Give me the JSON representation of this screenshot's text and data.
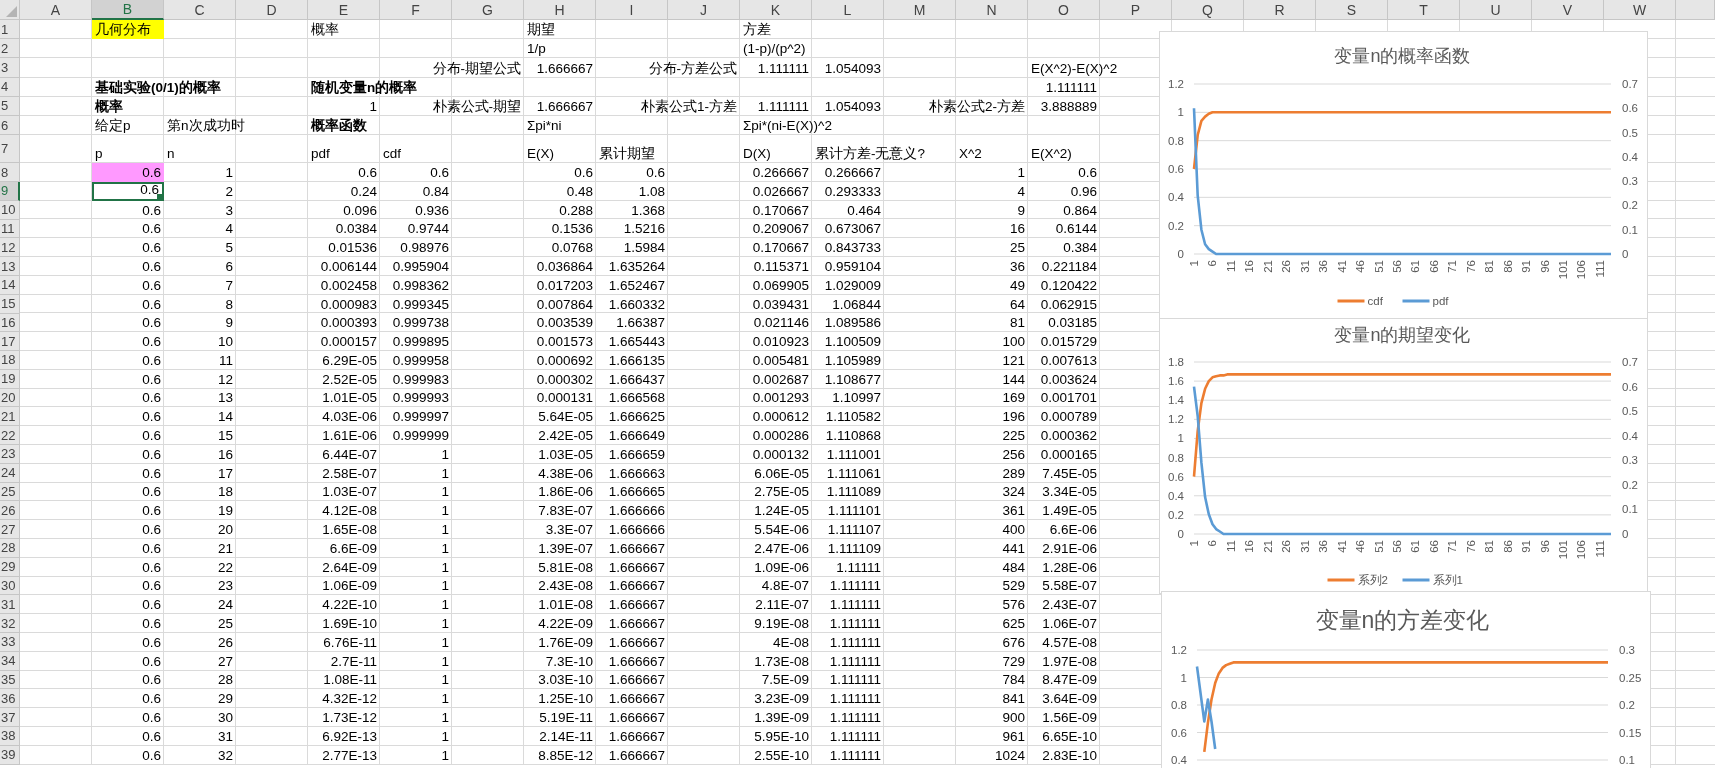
{
  "columns": [
    {
      "letter": "A",
      "selected": false
    },
    {
      "letter": "B",
      "selected": true
    },
    {
      "letter": "C",
      "selected": false
    },
    {
      "letter": "D",
      "selected": false
    },
    {
      "letter": "E",
      "selected": false
    },
    {
      "letter": "F",
      "selected": false
    },
    {
      "letter": "G",
      "selected": false
    },
    {
      "letter": "H",
      "selected": false
    },
    {
      "letter": "I",
      "selected": false
    },
    {
      "letter": "J",
      "selected": false
    },
    {
      "letter": "K",
      "selected": false
    },
    {
      "letter": "L",
      "selected": false
    },
    {
      "letter": "M",
      "selected": false
    },
    {
      "letter": "N",
      "selected": false
    },
    {
      "letter": "O",
      "selected": false
    },
    {
      "letter": "P",
      "selected": false
    },
    {
      "letter": "Q",
      "selected": false
    },
    {
      "letter": "R",
      "selected": false
    },
    {
      "letter": "S",
      "selected": false
    },
    {
      "letter": "T",
      "selected": false
    },
    {
      "letter": "U",
      "selected": false
    },
    {
      "letter": "V",
      "selected": false
    },
    {
      "letter": "W",
      "selected": false
    }
  ],
  "top_rows": [
    {
      "row": "1",
      "cells": [
        {},
        {
          "text": "几何分布",
          "color": "#ffff00"
        },
        {},
        {},
        {
          "text": "概率"
        },
        {},
        {},
        {
          "text": "期望"
        },
        {},
        {},
        {
          "text": "方差"
        }
      ]
    },
    {
      "row": "2",
      "cells": [
        {},
        {},
        {},
        {},
        {},
        {},
        {},
        {
          "text": "1/p"
        },
        {},
        {},
        {
          "text": "(1-p)/(p^2)"
        }
      ]
    },
    {
      "row": "3",
      "cells": [
        {},
        {},
        {},
        {},
        {},
        {},
        {
          "text": "分布-期望公式",
          "kind": "right"
        },
        {
          "text": "1.666667",
          "kind": "right"
        },
        {},
        {
          "text": "分布-方差公式",
          "kind": "right"
        },
        {
          "text": "1.111111",
          "kind": "right"
        },
        {
          "text": "1.054093",
          "kind": "right"
        },
        {},
        {},
        {
          "text": "E(X^2)-E(X)^2"
        }
      ]
    },
    {
      "row": "4",
      "cells": [
        {},
        {
          "text": "基础实验(0/1)的概率",
          "bold": true
        },
        {},
        {},
        {
          "text": "随机变量n的概率",
          "bold": true
        },
        {},
        {},
        {},
        {},
        {},
        {},
        {},
        {},
        {},
        {
          "text": "1.111111",
          "kind": "right"
        }
      ]
    },
    {
      "row": "5",
      "cells": [
        {},
        {
          "text": "概率",
          "bold": true
        },
        {},
        {},
        {
          "text": "1",
          "kind": "right"
        },
        {},
        {
          "text": "朴素公式-期望",
          "kind": "right"
        },
        {
          "text": "1.666667",
          "kind": "right"
        },
        {},
        {
          "text": "朴素公式1-方差",
          "kind": "right"
        },
        {
          "text": "1.111111",
          "kind": "right"
        },
        {
          "text": "1.054093",
          "kind": "right"
        },
        {},
        {
          "text": "朴素公式2-方差",
          "kind": "right"
        },
        {
          "text": "3.888889",
          "kind": "right"
        }
      ]
    },
    {
      "row": "6",
      "cells": [
        {},
        {
          "text": "给定p"
        },
        {
          "text": "第n次成功时"
        },
        {},
        {
          "text": "概率函数",
          "bold": true
        },
        {},
        {},
        {
          "text": "Σpi*ni"
        },
        {},
        {},
        {
          "text": "Σpi*(ni-E(X))^2"
        }
      ]
    },
    {
      "row": "7",
      "cells": [
        {},
        {
          "text": "p"
        },
        {
          "text": "n"
        },
        {},
        {
          "text": "pdf"
        },
        {
          "text": "cdf"
        },
        {},
        {
          "text": "E(X)"
        },
        {
          "text": "累计期望"
        },
        {},
        {
          "text": "D(X)"
        },
        {
          "text": "累计方差-无意义?"
        },
        {},
        {
          "text": "X^2"
        },
        {
          "text": "E(X^2)"
        }
      ]
    }
  ],
  "rows": [
    {
      "row": "8",
      "selected": false,
      "color": "#ff99ff",
      "cells": [
        "0.6",
        "1",
        "0.6",
        "0.6",
        "0.6",
        "0.6",
        "0.266667",
        "0.266667",
        "1",
        "0.6"
      ]
    },
    {
      "row": "9",
      "selected": true,
      "cells": [
        "0.6",
        "2",
        "0.24",
        "0.84",
        "0.48",
        "1.08",
        "0.026667",
        "0.293333",
        "4",
        "0.96"
      ]
    },
    {
      "row": "10",
      "selected": false,
      "cells": [
        "0.6",
        "3",
        "0.096",
        "0.936",
        "0.288",
        "1.368",
        "0.170667",
        "0.464",
        "9",
        "0.864"
      ]
    },
    {
      "row": "11",
      "selected": false,
      "cells": [
        "0.6",
        "4",
        "0.0384",
        "0.9744",
        "0.1536",
        "1.5216",
        "0.209067",
        "0.673067",
        "16",
        "0.6144"
      ]
    },
    {
      "row": "12",
      "selected": false,
      "cells": [
        "0.6",
        "5",
        "0.01536",
        "0.98976",
        "0.0768",
        "1.5984",
        "0.170667",
        "0.843733",
        "25",
        "0.384"
      ]
    },
    {
      "row": "13",
      "selected": false,
      "cells": [
        "0.6",
        "6",
        "0.006144",
        "0.995904",
        "0.036864",
        "1.635264",
        "0.115371",
        "0.959104",
        "36",
        "0.221184"
      ]
    },
    {
      "row": "14",
      "selected": false,
      "cells": [
        "0.6",
        "7",
        "0.002458",
        "0.998362",
        "0.017203",
        "1.652467",
        "0.069905",
        "1.029009",
        "49",
        "0.120422"
      ]
    },
    {
      "row": "15",
      "selected": false,
      "cells": [
        "0.6",
        "8",
        "0.000983",
        "0.999345",
        "0.007864",
        "1.660332",
        "0.039431",
        "1.06844",
        "64",
        "0.062915"
      ]
    },
    {
      "row": "16",
      "selected": false,
      "cells": [
        "0.6",
        "9",
        "0.000393",
        "0.999738",
        "0.003539",
        "1.66387",
        "0.021146",
        "1.089586",
        "81",
        "0.03185"
      ]
    },
    {
      "row": "17",
      "selected": false,
      "cells": [
        "0.6",
        "10",
        "0.000157",
        "0.999895",
        "0.001573",
        "1.665443",
        "0.010923",
        "1.100509",
        "100",
        "0.015729"
      ]
    },
    {
      "row": "18",
      "selected": false,
      "cells": [
        "0.6",
        "11",
        "6.29E-05",
        "0.999958",
        "0.000692",
        "1.666135",
        "0.005481",
        "1.105989",
        "121",
        "0.007613"
      ]
    },
    {
      "row": "19",
      "selected": false,
      "cells": [
        "0.6",
        "12",
        "2.52E-05",
        "0.999983",
        "0.000302",
        "1.666437",
        "0.002687",
        "1.108677",
        "144",
        "0.003624"
      ]
    },
    {
      "row": "20",
      "selected": false,
      "cells": [
        "0.6",
        "13",
        "1.01E-05",
        "0.999993",
        "0.000131",
        "1.666568",
        "0.001293",
        "1.10997",
        "169",
        "0.001701"
      ]
    },
    {
      "row": "21",
      "selected": false,
      "cells": [
        "0.6",
        "14",
        "4.03E-06",
        "0.999997",
        "5.64E-05",
        "1.666625",
        "0.000612",
        "1.110582",
        "196",
        "0.000789"
      ]
    },
    {
      "row": "22",
      "selected": false,
      "cells": [
        "0.6",
        "15",
        "1.61E-06",
        "0.999999",
        "2.42E-05",
        "1.666649",
        "0.000286",
        "1.110868",
        "225",
        "0.000362"
      ]
    },
    {
      "row": "23",
      "selected": false,
      "cells": [
        "0.6",
        "16",
        "6.44E-07",
        "1",
        "1.03E-05",
        "1.666659",
        "0.000132",
        "1.111001",
        "256",
        "0.000165"
      ]
    },
    {
      "row": "24",
      "selected": false,
      "cells": [
        "0.6",
        "17",
        "2.58E-07",
        "1",
        "4.38E-06",
        "1.666663",
        "6.06E-05",
        "1.111061",
        "289",
        "7.45E-05"
      ]
    },
    {
      "row": "25",
      "selected": false,
      "cells": [
        "0.6",
        "18",
        "1.03E-07",
        "1",
        "1.86E-06",
        "1.666665",
        "2.75E-05",
        "1.111089",
        "324",
        "3.34E-05"
      ]
    },
    {
      "row": "26",
      "selected": false,
      "cells": [
        "0.6",
        "19",
        "4.12E-08",
        "1",
        "7.83E-07",
        "1.666666",
        "1.24E-05",
        "1.111101",
        "361",
        "1.49E-05"
      ]
    },
    {
      "row": "27",
      "selected": false,
      "cells": [
        "0.6",
        "20",
        "1.65E-08",
        "1",
        "3.3E-07",
        "1.666666",
        "5.54E-06",
        "1.111107",
        "400",
        "6.6E-06"
      ]
    },
    {
      "row": "28",
      "selected": false,
      "cells": [
        "0.6",
        "21",
        "6.6E-09",
        "1",
        "1.39E-07",
        "1.666667",
        "2.47E-06",
        "1.111109",
        "441",
        "2.91E-06"
      ]
    },
    {
      "row": "29",
      "selected": false,
      "cells": [
        "0.6",
        "22",
        "2.64E-09",
        "1",
        "5.81E-08",
        "1.666667",
        "1.09E-06",
        "1.11111",
        "484",
        "1.28E-06"
      ]
    },
    {
      "row": "30",
      "selected": false,
      "cells": [
        "0.6",
        "23",
        "1.06E-09",
        "1",
        "2.43E-08",
        "1.666667",
        "4.8E-07",
        "1.111111",
        "529",
        "5.58E-07"
      ]
    },
    {
      "row": "31",
      "selected": false,
      "cells": [
        "0.6",
        "24",
        "4.22E-10",
        "1",
        "1.01E-08",
        "1.666667",
        "2.11E-07",
        "1.111111",
        "576",
        "2.43E-07"
      ]
    },
    {
      "row": "32",
      "selected": false,
      "cells": [
        "0.6",
        "25",
        "1.69E-10",
        "1",
        "4.22E-09",
        "1.666667",
        "9.19E-08",
        "1.111111",
        "625",
        "1.06E-07"
      ]
    },
    {
      "row": "33",
      "selected": false,
      "cells": [
        "0.6",
        "26",
        "6.76E-11",
        "1",
        "1.76E-09",
        "1.666667",
        "4E-08",
        "1.111111",
        "676",
        "4.57E-08"
      ]
    },
    {
      "row": "34",
      "selected": false,
      "cells": [
        "0.6",
        "27",
        "2.7E-11",
        "1",
        "7.3E-10",
        "1.666667",
        "1.73E-08",
        "1.111111",
        "729",
        "1.97E-08"
      ]
    },
    {
      "row": "35",
      "selected": false,
      "cells": [
        "0.6",
        "28",
        "1.08E-11",
        "1",
        "3.03E-10",
        "1.666667",
        "7.5E-09",
        "1.111111",
        "784",
        "8.47E-09"
      ]
    },
    {
      "row": "36",
      "selected": false,
      "cells": [
        "0.6",
        "29",
        "4.32E-12",
        "1",
        "1.25E-10",
        "1.666667",
        "3.23E-09",
        "1.111111",
        "841",
        "3.64E-09"
      ]
    },
    {
      "row": "37",
      "selected": false,
      "cells": [
        "0.6",
        "30",
        "1.73E-12",
        "1",
        "5.19E-11",
        "1.666667",
        "1.39E-09",
        "1.111111",
        "900",
        "1.56E-09"
      ]
    },
    {
      "row": "38",
      "selected": false,
      "cells": [
        "0.6",
        "31",
        "6.92E-13",
        "1",
        "2.14E-11",
        "1.666667",
        "5.95E-10",
        "1.111111",
        "961",
        "6.65E-10"
      ]
    },
    {
      "row": "39",
      "selected": false,
      "cells": [
        "0.6",
        "32",
        "2.77E-13",
        "1",
        "8.85E-12",
        "1.666667",
        "2.55E-10",
        "1.111111",
        "1024",
        "2.83E-10"
      ]
    }
  ],
  "charts": [
    {
      "chart_data": {
        "type": "line",
        "title": "变量n的概率函数",
        "grid": true,
        "legend": "bottom",
        "x": [
          1,
          2,
          3,
          4,
          5,
          6,
          7,
          8,
          9,
          10,
          11,
          114
        ],
        "xlim": [
          1,
          114
        ],
        "xticks": [
          1,
          6,
          11,
          16,
          21,
          26,
          31,
          36,
          41,
          46,
          51,
          56,
          61,
          66,
          71,
          76,
          81,
          86,
          91,
          96,
          101,
          106,
          111
        ],
        "ylim": [
          0,
          1.2
        ],
        "yticks": [
          0,
          0.2,
          0.4,
          0.6,
          0.8,
          1,
          1.2
        ],
        "y2lim": [
          0,
          0.7
        ],
        "y2ticks": [
          0,
          0.1,
          0.2,
          0.3,
          0.4,
          0.5,
          0.6,
          0.7
        ],
        "series": [
          {
            "name": "cdf",
            "color": "#ed7d31",
            "values": [
              0.6,
              0.84,
              0.94,
              0.97,
              0.99,
              1,
              1,
              1,
              1,
              1,
              1,
              1
            ]
          },
          {
            "name": "pdf",
            "color": "#5b9bd5",
            "axis": "y2",
            "values": [
              0.6,
              0.24,
              0.1,
              0.04,
              0.02,
              0.01,
              0,
              0,
              0,
              0,
              0,
              0
            ]
          }
        ]
      }
    },
    {
      "chart_data": {
        "type": "line",
        "title": "变量n的期望变化",
        "grid": true,
        "legend": "bottom",
        "x": [
          1,
          2,
          3,
          4,
          5,
          6,
          7,
          8,
          9,
          10,
          11,
          114
        ],
        "xlim": [
          1,
          114
        ],
        "xticks": [
          1,
          6,
          11,
          16,
          21,
          26,
          31,
          36,
          41,
          46,
          51,
          56,
          61,
          66,
          71,
          76,
          81,
          86,
          91,
          96,
          101,
          106,
          111
        ],
        "ylim": [
          0,
          1.8
        ],
        "yticks": [
          0,
          0.2,
          0.4,
          0.6,
          0.8,
          1,
          1.2,
          1.4,
          1.6,
          1.8
        ],
        "y2lim": [
          0,
          0.7
        ],
        "y2ticks": [
          0,
          0.1,
          0.2,
          0.3,
          0.4,
          0.5,
          0.6,
          0.7
        ],
        "series": [
          {
            "name": "系列2",
            "color": "#ed7d31",
            "values": [
              0.6,
              1.08,
              1.37,
              1.52,
              1.6,
              1.64,
              1.65,
              1.66,
              1.66,
              1.67,
              1.67,
              1.67
            ]
          },
          {
            "name": "系列1",
            "color": "#5b9bd5",
            "axis": "y2",
            "values": [
              0.6,
              0.48,
              0.29,
              0.15,
              0.08,
              0.04,
              0.02,
              0.01,
              0,
              0,
              0,
              0
            ]
          }
        ]
      }
    },
    {
      "chart_data": {
        "type": "line",
        "title": "变量n的方差变化",
        "grid": true,
        "x": [
          1,
          3,
          4,
          5,
          6,
          7,
          8,
          9,
          10,
          11,
          114
        ],
        "xlim": [
          1,
          114
        ],
        "ylim": [
          0.4,
          1.2
        ],
        "yticks": [
          0.4,
          0.6,
          0.8,
          1,
          1.2
        ],
        "y2lim": [
          0.1,
          0.3
        ],
        "y2ticks": [
          0.1,
          0.15,
          0.2,
          0.25,
          0.3
        ],
        "series": [
          {
            "color": "#ed7d31",
            "values": [
              null,
              0.46,
              0.67,
              0.84,
              0.96,
              1.03,
              1.07,
              1.09,
              1.1,
              1.11,
              1.11
            ]
          },
          {
            "color": "#5b9bd5",
            "axis": "y2",
            "values": [
              0.27,
              0.17,
              0.21,
              0.17,
              0.12,
              null,
              null,
              null,
              null,
              null,
              null
            ]
          }
        ]
      }
    }
  ]
}
